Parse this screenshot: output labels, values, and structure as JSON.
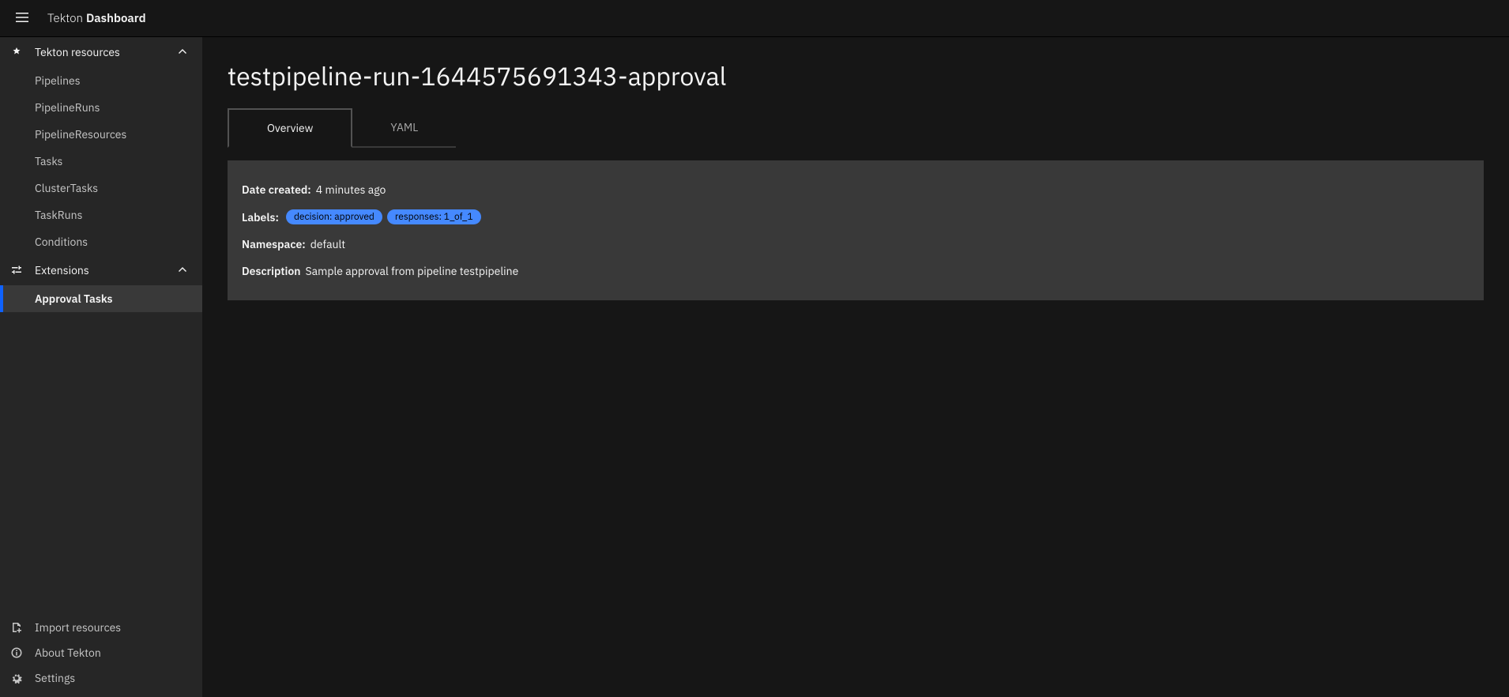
{
  "header": {
    "title_prefix": "Tekton",
    "title_suffix": "Dashboard"
  },
  "sidebar": {
    "groups": [
      {
        "label": "Tekton resources",
        "icon": "tekton-icon",
        "items": [
          {
            "label": "Pipelines",
            "active": false
          },
          {
            "label": "PipelineRuns",
            "active": false
          },
          {
            "label": "PipelineResources",
            "active": false
          },
          {
            "label": "Tasks",
            "active": false
          },
          {
            "label": "ClusterTasks",
            "active": false
          },
          {
            "label": "TaskRuns",
            "active": false
          },
          {
            "label": "Conditions",
            "active": false
          }
        ]
      },
      {
        "label": "Extensions",
        "icon": "settings-adjust-icon",
        "items": [
          {
            "label": "Approval Tasks",
            "active": true
          }
        ]
      }
    ],
    "footer": [
      {
        "label": "Import resources",
        "icon": "import-icon"
      },
      {
        "label": "About Tekton",
        "icon": "info-icon"
      },
      {
        "label": "Settings",
        "icon": "settings-icon"
      }
    ]
  },
  "main": {
    "title": "testpipeline-run-1644575691343-approval",
    "tabs": [
      {
        "label": "Overview",
        "active": true
      },
      {
        "label": "YAML",
        "active": false
      }
    ],
    "details": {
      "date_created_label": "Date created:",
      "date_created_value": "4 minutes ago",
      "labels_label": "Labels:",
      "labels_tags": [
        "decision: approved",
        "responses: 1_of_1"
      ],
      "namespace_label": "Namespace:",
      "namespace_value": "default",
      "description_label": "Description",
      "description_value": "Sample approval from pipeline testpipeline"
    }
  }
}
